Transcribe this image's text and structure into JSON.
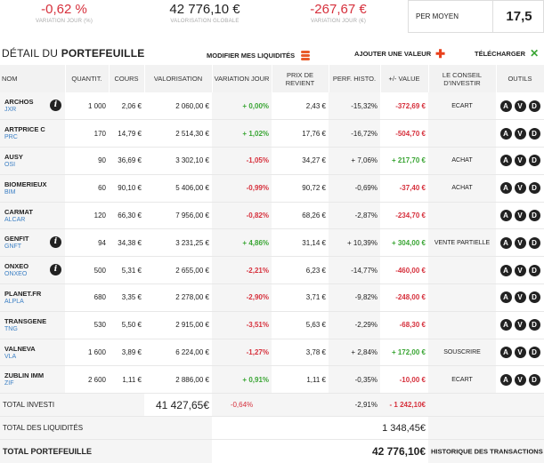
{
  "summary": {
    "variation_jour_pct": "-0,62 %",
    "variation_jour_pct_label": "VARIATION JOUR (%)",
    "valorisation_globale": "42 776,10 €",
    "valorisation_globale_label": "VALORISATION GLOBALE",
    "variation_jour_eur": "-267,67 €",
    "variation_jour_eur_label": "VARIATION JOUR (€)",
    "per_moyen_label": "PER MOYEN",
    "per_moyen_value": "17,5"
  },
  "section": {
    "title_light": "DÉTAIL DU ",
    "title_bold": "PORTEFEUILLE",
    "modify_label": "MODIFIER MES LIQUIDITÉS",
    "add_label": "AJOUTER UNE VALEUR",
    "download_label": "TÉLÉCHARGER"
  },
  "columns": [
    "NOM",
    "QUANTIT.",
    "COURS",
    "VALORISATION",
    "VARIATION JOUR",
    "PRIX DE REVIENT",
    "PERF. HISTO.",
    "+/- VALUE",
    "LE CONSEIL D'INVESTIR",
    "OUTILS"
  ],
  "rows": [
    {
      "name": "ARCHOS",
      "ticker": "JXR",
      "info": true,
      "qty": "1 000",
      "cours": "2,06 €",
      "valo": "2 060,00 €",
      "var": "+ 0,00%",
      "var_color": "green",
      "prix": "2,43 €",
      "perf": "-15,32%",
      "pv": "-372,69 €",
      "pv_color": "red",
      "conseil": "ECART"
    },
    {
      "name": "ARTPRICE C",
      "ticker": "PRC",
      "info": false,
      "qty": "170",
      "cours": "14,79 €",
      "valo": "2 514,30 €",
      "var": "+ 1,02%",
      "var_color": "green",
      "prix": "17,76 €",
      "perf": "-16,72%",
      "pv": "-504,70 €",
      "pv_color": "red",
      "conseil": ""
    },
    {
      "name": "AUSY",
      "ticker": "OSI",
      "info": false,
      "qty": "90",
      "cours": "36,69 €",
      "valo": "3 302,10 €",
      "var": "-1,05%",
      "var_color": "red",
      "prix": "34,27 €",
      "perf": "+ 7,06%",
      "pv": "+ 217,70 €",
      "pv_color": "green",
      "conseil": "ACHAT"
    },
    {
      "name": "BIOMERIEUX",
      "ticker": "BIM",
      "info": false,
      "qty": "60",
      "cours": "90,10 €",
      "valo": "5 406,00 €",
      "var": "-0,99%",
      "var_color": "red",
      "prix": "90,72 €",
      "perf": "-0,69%",
      "pv": "-37,40 €",
      "pv_color": "red",
      "conseil": "ACHAT"
    },
    {
      "name": "CARMAT",
      "ticker": "ALCAR",
      "info": false,
      "qty": "120",
      "cours": "66,30 €",
      "valo": "7 956,00 €",
      "var": "-0,82%",
      "var_color": "red",
      "prix": "68,26 €",
      "perf": "-2,87%",
      "pv": "-234,70 €",
      "pv_color": "red",
      "conseil": ""
    },
    {
      "name": "GENFIT",
      "ticker": "GNFT",
      "info": true,
      "qty": "94",
      "cours": "34,38 €",
      "valo": "3 231,25 €",
      "var": "+ 4,86%",
      "var_color": "green",
      "prix": "31,14 €",
      "perf": "+ 10,39%",
      "pv": "+ 304,00 €",
      "pv_color": "green",
      "conseil": "VENTE PARTIELLE"
    },
    {
      "name": "ONXEO",
      "ticker": "ONXEO",
      "info": true,
      "qty": "500",
      "cours": "5,31 €",
      "valo": "2 655,00 €",
      "var": "-2,21%",
      "var_color": "red",
      "prix": "6,23 €",
      "perf": "-14,77%",
      "pv": "-460,00 €",
      "pv_color": "red",
      "conseil": ""
    },
    {
      "name": "PLANET.FR",
      "ticker": "ALPLA",
      "info": false,
      "qty": "680",
      "cours": "3,35 €",
      "valo": "2 278,00 €",
      "var": "-2,90%",
      "var_color": "red",
      "prix": "3,71 €",
      "perf": "-9,82%",
      "pv": "-248,00 €",
      "pv_color": "red",
      "conseil": ""
    },
    {
      "name": "TRANSGENE",
      "ticker": "TNG",
      "info": false,
      "qty": "530",
      "cours": "5,50 €",
      "valo": "2 915,00 €",
      "var": "-3,51%",
      "var_color": "red",
      "prix": "5,63 €",
      "perf": "-2,29%",
      "pv": "-68,30 €",
      "pv_color": "red",
      "conseil": ""
    },
    {
      "name": "VALNEVA",
      "ticker": "VLA",
      "info": false,
      "qty": "1 600",
      "cours": "3,89 €",
      "valo": "6 224,00 €",
      "var": "-1,27%",
      "var_color": "red",
      "prix": "3,78 €",
      "perf": "+ 2,84%",
      "pv": "+ 172,00 €",
      "pv_color": "green",
      "conseil": "SOUSCRIRE"
    },
    {
      "name": "ZUBLIN IMM",
      "ticker": "ZIF",
      "info": false,
      "qty": "2 600",
      "cours": "1,11 €",
      "valo": "2 886,00 €",
      "var": "+ 0,91%",
      "var_color": "green",
      "prix": "1,11 €",
      "perf": "-0,35%",
      "pv": "-10,00 €",
      "pv_color": "red",
      "conseil": "ECART"
    }
  ],
  "tools": [
    "A",
    "V",
    "D"
  ],
  "totals": {
    "investi_label": "TOTAL INVESTI",
    "investi_value": "41 427,65€",
    "investi_var": "-0,64%",
    "investi_perf": "-2,91%",
    "investi_pv": "- 1 242,10€",
    "liquidites_label": "TOTAL DES LIQUIDITÉS",
    "liquidites_value": "1 348,45€",
    "portefeuille_label": "TOTAL PORTEFEUILLE",
    "portefeuille_value": "42 776,10€",
    "historique_label": "HISTORIQUE DES TRANSACTIONS"
  },
  "colors": {
    "red": "#d6303c",
    "green": "#3aa534",
    "accent": "#e85b2a"
  }
}
